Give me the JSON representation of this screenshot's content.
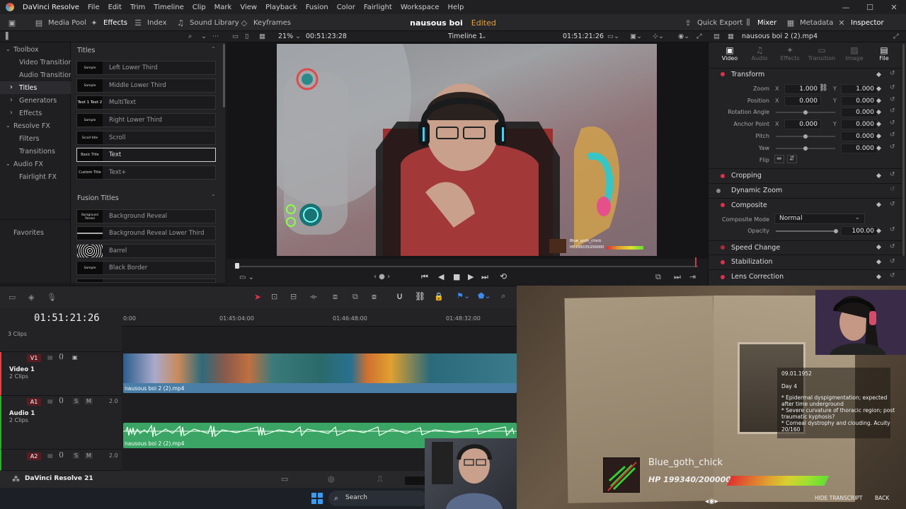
{
  "menubar": {
    "app": "DaVinci Resolve",
    "items": [
      "File",
      "Edit",
      "Trim",
      "Timeline",
      "Clip",
      "Mark",
      "View",
      "Playback",
      "Fusion",
      "Color",
      "Fairlight",
      "Workspace",
      "Help"
    ]
  },
  "toolbar": {
    "media_pool": "Media Pool",
    "effects": "Effects",
    "index": "Index",
    "sound_library": "Sound Library",
    "keyframes": "Keyframes",
    "project": "nausous boi",
    "edited": "Edited",
    "quick_export": "Quick Export",
    "mixer": "Mixer",
    "metadata": "Metadata",
    "inspector": "Inspector"
  },
  "viewer_header": {
    "zoom": "21%",
    "source_tc": "00:51:23:28",
    "timeline": "Timeline 1",
    "record_tc": "01:51:21:26"
  },
  "inspector_header": {
    "clip": "nausous boi 2 (2).mp4"
  },
  "leftnav": {
    "toolbox": "Toolbox",
    "video_transitions": "Video Transitions",
    "audio_transitions": "Audio Transitions",
    "titles": "Titles",
    "generators": "Generators",
    "effects": "Effects",
    "resolve_fx": "Resolve FX",
    "filters": "Filters",
    "transitions": "Transitions",
    "audio_fx": "Audio FX",
    "fairlight_fx": "Fairlight FX",
    "favorites": "Favorites"
  },
  "effects": {
    "titles_header": "Titles",
    "titles": [
      {
        "label": "Left Lower Third",
        "thumb": "Sample"
      },
      {
        "label": "Middle Lower Third",
        "thumb": "Sample"
      },
      {
        "label": "MultiText",
        "thumb": "Text 1 Text 2"
      },
      {
        "label": "Right Lower Third",
        "thumb": "Sample"
      },
      {
        "label": "Scroll",
        "thumb": "Scroll title"
      },
      {
        "label": "Text",
        "thumb": "Basic Title"
      },
      {
        "label": "Text+",
        "thumb": "Custom Title"
      }
    ],
    "fusion_header": "Fusion Titles",
    "fusion": [
      {
        "label": "Background Reveal",
        "thumb": "Background Reveal"
      },
      {
        "label": "Background Reveal Lower Third",
        "thumb": ""
      },
      {
        "label": "Barrel",
        "thumb": ""
      },
      {
        "label": "Black Border",
        "thumb": "Sample"
      }
    ]
  },
  "inspector": {
    "tabs": [
      "Video",
      "Audio",
      "Effects",
      "Transition",
      "Image",
      "File"
    ],
    "transform": "Transform",
    "zoom_label": "Zoom",
    "zoom_x": "1.000",
    "zoom_y": "1.000",
    "position_label": "Position",
    "pos_x": "0.000",
    "pos_y": "0.000",
    "rotation_label": "Rotation Angle",
    "rotation": "0.000",
    "anchor_label": "Anchor Point",
    "anchor_x": "0.000",
    "anchor_y": "0.000",
    "pitch_label": "Pitch",
    "pitch": "0.000",
    "yaw_label": "Yaw",
    "yaw": "0.000",
    "flip_label": "Flip",
    "x": "X",
    "y": "Y",
    "cropping": "Cropping",
    "dynamic_zoom": "Dynamic Zoom",
    "composite": "Composite",
    "composite_mode_label": "Composite Mode",
    "composite_mode": "Normal",
    "opacity_label": "Opacity",
    "opacity": "100.00",
    "speed_change": "Speed Change",
    "stabilization": "Stabilization",
    "lens_correction": "Lens Correction"
  },
  "timeline": {
    "timecode": "01:51:21:26",
    "ruler": [
      "0:00",
      "01:45:04:00",
      "01:46:48:00",
      "01:48:32:00"
    ],
    "track_top_clips": "3 Clips",
    "v1": "V1",
    "video1": "Video 1",
    "video1_clips": "2 Clips",
    "a1": "A1",
    "audio1": "Audio 1",
    "audio1_clips": "2 Clips",
    "a2": "A2",
    "s": "S",
    "m": "M",
    "vol": "2.0",
    "video_clip_name": "nausous boi 2 (2).mp4",
    "audio_clip_name": "nausous boi 2 (2).mp4"
  },
  "bottombar": {
    "brand": "DaVinci Resolve 21"
  },
  "taskbar": {
    "search": "Search"
  },
  "stream": {
    "notes": [
      "09.01.1952",
      "Day 4",
      "* Epidermal dyspigmentation; expected",
      "after time underground",
      "* Severe curvature of thoracic region; post",
      "traumatic kyphosis?",
      "* Corneal dystrophy and clouding. Acuity",
      "20/160"
    ],
    "hud_name": "Blue_goth_chick",
    "hud_hp": "HP 199340/200000",
    "hide_transcript": "HIDE TRANSCRIPT",
    "back": "BACK",
    "video_hud_name": "Blue_goth_chick",
    "video_hud_hp": "HP 199335/200000"
  },
  "colors": {
    "accent_red": "#e0304a",
    "video_clip": "#4a7ea6",
    "audio_clip": "#3aa565",
    "edited": "#e6a23c"
  }
}
